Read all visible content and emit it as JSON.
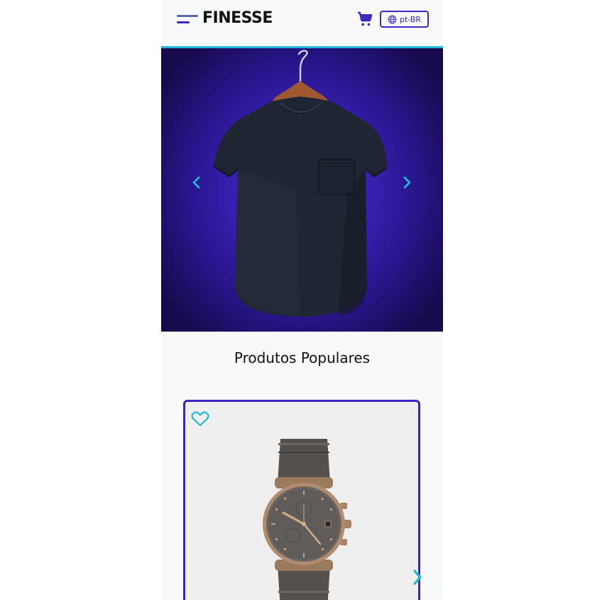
{
  "header": {
    "brand": "FINESSE",
    "menu_icon": "hamburger-menu-icon",
    "cart_icon": "shopping-cart-icon",
    "language": {
      "icon": "globe-icon",
      "label": "pt-BR"
    }
  },
  "hero": {
    "image": "dark navy t-shirt on wooden hanger",
    "prev_icon": "chevron-left-icon",
    "next_icon": "chevron-right-icon"
  },
  "popular": {
    "title": "Produtos Populares",
    "products": [
      {
        "image": "wristwatch with brown leather strap",
        "favorite_icon": "heart-outline-icon"
      }
    ],
    "next_icon": "chevron-right-icon"
  },
  "colors": {
    "primary": "#3a2bbf",
    "accent": "#21b8d7",
    "background": "#f7f9fb"
  }
}
